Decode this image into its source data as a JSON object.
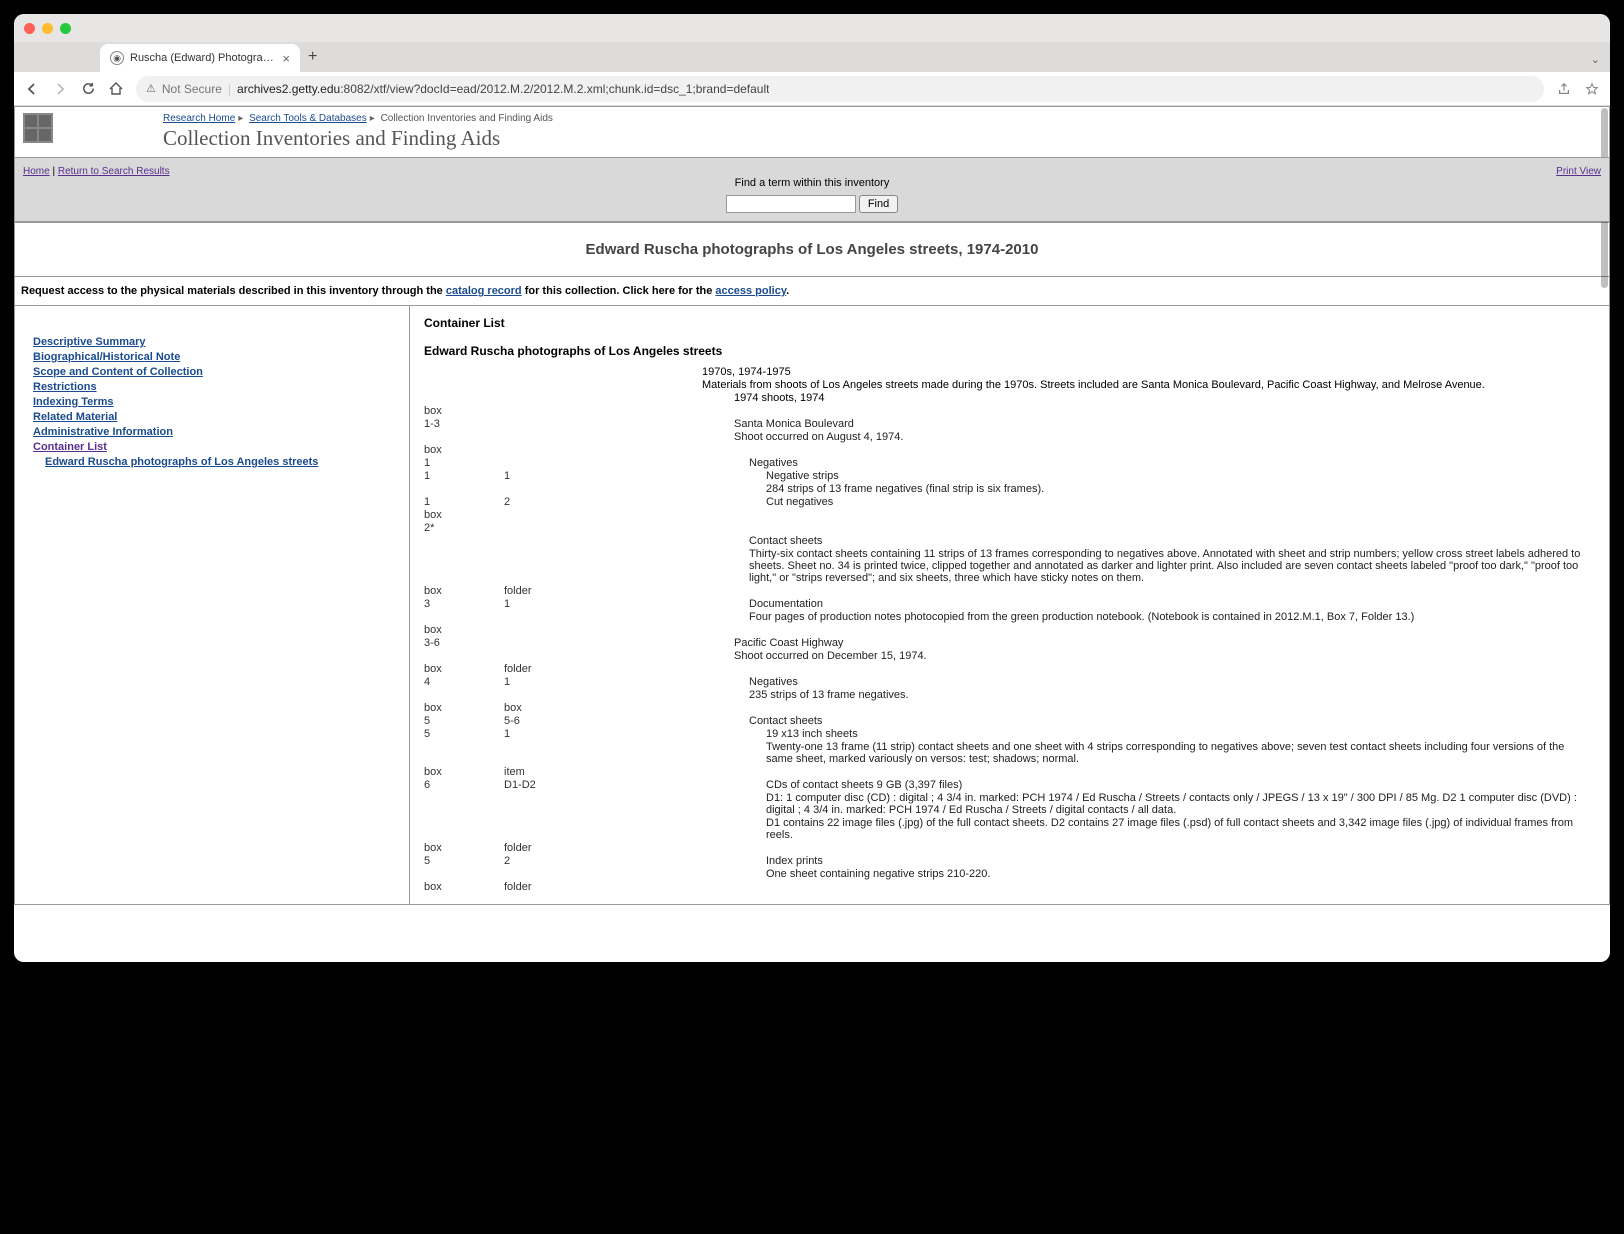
{
  "browser": {
    "tab_title": "Ruscha (Edward) Photographs",
    "not_secure_label": "Not Secure",
    "url_host": "archives2.getty.edu",
    "url_path": ":8082/xtf/view?docId=ead/2012.M.2/2012.M.2.xml;chunk.id=dsc_1;brand=default"
  },
  "banner": {
    "crumb1": "Research Home",
    "crumb2": "Search Tools & Databases",
    "crumb3": "Collection Inventories and Finding Aids",
    "title": "Collection Inventories and Finding Aids"
  },
  "greybar": {
    "home": "Home",
    "sep": " | ",
    "return": "Return to Search Results",
    "print": "Print View",
    "find_label": "Find a term within this inventory",
    "find_btn": "Find"
  },
  "collection_title": "Edward Ruscha photographs of Los Angeles streets, 1974-2010",
  "access": {
    "p1": "Request access to the physical materials described in this inventory through the ",
    "link1": "catalog record",
    "p2": " for this collection. Click here for the ",
    "link2": "access policy",
    "p3": "."
  },
  "nav": {
    "i0": "Descriptive Summary",
    "i1": "Biographical/Historical Note",
    "i2": "Scope and Content of Collection",
    "i3": "Restrictions",
    "i4": "Indexing Terms",
    "i5": "Related Material",
    "i6": "Administrative Information",
    "i7": "Container List",
    "sub": "Edward Ruscha photographs of Los Angeles streets"
  },
  "content": {
    "heading": "Container List",
    "series": "Edward Ruscha photographs of Los Angeles streets",
    "decade_title": "1970s, 1974-1975",
    "decade_note": "Materials from shoots of Los Angeles streets made during the 1970s. Streets included are Santa Monica Boulevard, Pacific Coast Highway, and Melrose Avenue.",
    "shoots74": "1974 shoots, 1974",
    "rows": [
      {
        "c1": "box",
        "c2": "",
        "t": "",
        "lvl": 0
      },
      {
        "c1": "1-3",
        "c2": "",
        "t": "Santa Monica Boulevard",
        "lvl": 2
      },
      {
        "c1": "",
        "c2": "",
        "t": "Shoot occurred on August 4, 1974.",
        "lvl": 2,
        "note": true
      },
      {
        "c1": "box",
        "c2": "",
        "t": "",
        "lvl": 0
      },
      {
        "c1": "1",
        "c2": "",
        "t": "Negatives",
        "lvl": 3
      },
      {
        "c1": "1",
        "c2": "1",
        "t": "Negative strips",
        "lvl": 4
      },
      {
        "c1": "",
        "c2": "",
        "t": "284 strips of 13 frame negatives (final strip is six frames).",
        "lvl": 4,
        "note": true
      },
      {
        "c1": "1",
        "c2": "2",
        "t": "Cut negatives",
        "lvl": 4
      },
      {
        "c1": "box",
        "c2": "",
        "t": "",
        "lvl": 0
      },
      {
        "c1": "2*",
        "c2": "",
        "t": "",
        "lvl": 0
      },
      {
        "c1": "",
        "c2": "",
        "t": "Contact sheets",
        "lvl": 3
      },
      {
        "c1": "",
        "c2": "",
        "t": "Thirty-six contact sheets containing 11 strips of 13 frames corresponding to negatives above. Annotated with sheet and strip numbers; yellow cross street labels adhered to sheets. Sheet no. 34 is printed twice, clipped together and annotated as darker and lighter print. Also included are seven contact sheets labeled \"proof too dark,\" \"proof too light,\" or \"strips reversed\"; and six sheets, three which have sticky notes on them.",
        "lvl": 3,
        "note": true
      },
      {
        "c1": "box",
        "c2": "folder",
        "t": "",
        "lvl": 0
      },
      {
        "c1": "3",
        "c2": "1",
        "t": "Documentation",
        "lvl": 3
      },
      {
        "c1": "",
        "c2": "",
        "t": "Four pages of production notes photocopied from the green production notebook. (Notebook is contained in 2012.M.1, Box 7, Folder 13.)",
        "lvl": 3,
        "note": true
      },
      {
        "c1": "box",
        "c2": "",
        "t": "",
        "lvl": 0
      },
      {
        "c1": "3-6",
        "c2": "",
        "t": "Pacific Coast Highway",
        "lvl": 2
      },
      {
        "c1": "",
        "c2": "",
        "t": "Shoot occurred on December 15, 1974.",
        "lvl": 2,
        "note": true
      },
      {
        "c1": "box",
        "c2": "folder",
        "t": "",
        "lvl": 0
      },
      {
        "c1": "4",
        "c2": "1",
        "t": "Negatives",
        "lvl": 3
      },
      {
        "c1": "",
        "c2": "",
        "t": "235 strips of 13 frame negatives.",
        "lvl": 3,
        "note": true
      },
      {
        "c1": "box",
        "c2": "box",
        "t": "",
        "lvl": 0
      },
      {
        "c1": "5",
        "c2": "5-6",
        "t": "Contact sheets",
        "lvl": 3
      },
      {
        "c1": "5",
        "c2": "1",
        "t": "19 x13 inch sheets",
        "lvl": 4
      },
      {
        "c1": "",
        "c2": "",
        "t": "Twenty-one 13 frame (11 strip) contact sheets and one sheet with 4 strips corresponding to negatives above; seven test contact sheets including four versions of the same sheet, marked variously on versos: test; shadows; normal.",
        "lvl": 4,
        "note": true
      },
      {
        "c1": "box",
        "c2": "item",
        "t": "",
        "lvl": 0
      },
      {
        "c1": "6",
        "c2": "D1-D2",
        "t": "CDs of contact sheets 9 GB (3,397 files)",
        "lvl": 4
      },
      {
        "c1": "",
        "c2": "",
        "t": "D1: 1 computer disc (CD) : digital ; 4 3/4 in. marked: PCH 1974 / Ed Ruscha / Streets / contacts only / JPEGS / 13 x 19\" / 300 DPI / 85 Mg. D2 1 computer disc (DVD) : digital ; 4 3/4 in. marked: PCH 1974 / Ed Ruscha / Streets / digital contacts / all data.",
        "lvl": 4,
        "note": true
      },
      {
        "c1": "",
        "c2": "",
        "t": "D1 contains 22 image files (.jpg) of the full contact sheets. D2 contains 27 image files (.psd) of full contact sheets and 3,342 image files (.jpg) of individual frames from reels.",
        "lvl": 4,
        "note": true
      },
      {
        "c1": "box",
        "c2": "folder",
        "t": "",
        "lvl": 0
      },
      {
        "c1": "5",
        "c2": "2",
        "t": "Index prints",
        "lvl": 4
      },
      {
        "c1": "",
        "c2": "",
        "t": "One sheet containing negative strips 210-220.",
        "lvl": 4,
        "note": true
      },
      {
        "c1": "box",
        "c2": "folder",
        "t": "",
        "lvl": 0
      }
    ]
  }
}
